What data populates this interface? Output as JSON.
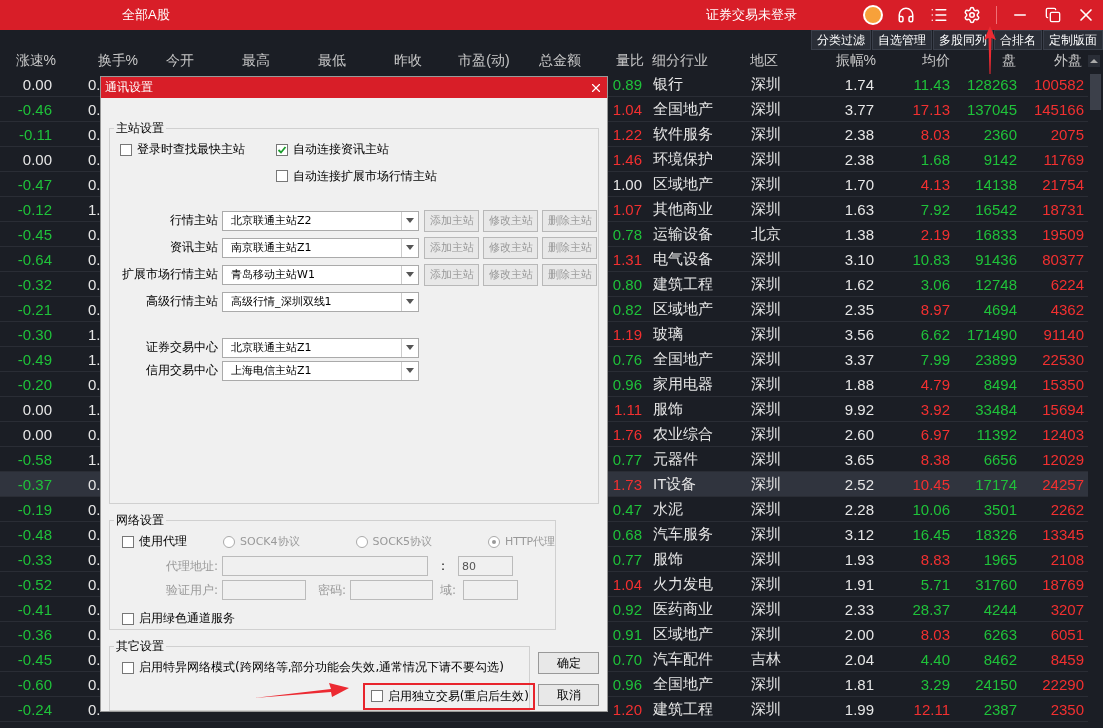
{
  "top_bar": {
    "title": "全部A股",
    "status": "证券交易未登录"
  },
  "toolbar": [
    "分类过滤",
    "自选管理",
    "多股同列",
    "合排名",
    "定制版面"
  ],
  "table": {
    "columns": [
      "涨速%",
      "换手%",
      "今开",
      "最高",
      "最低",
      "昨收",
      "市盈(动)",
      "总金额",
      "量比",
      "细分行业",
      "地区",
      "振幅%",
      "均价",
      "盘",
      "外盘"
    ],
    "rows": [
      {
        "selected": false,
        "cells": [
          {
            "text": "0.00",
            "color": "#e6e6e6"
          },
          {
            "text": "0.",
            "color": "#e6e6e6"
          },
          null,
          null,
          null,
          null,
          null,
          null,
          {
            "text": "0.89",
            "color": "#1fc23a"
          },
          {
            "text": "银行",
            "color": "#e6e6e6"
          },
          {
            "text": "深圳",
            "color": "#e6e6e6"
          },
          {
            "text": "1.74",
            "color": "#e6e6e6"
          },
          {
            "text": "11.43",
            "color": "#1fc23a"
          },
          {
            "text": "128263",
            "color": "#1fc23a"
          },
          {
            "text": "100582",
            "color": "#f23030"
          }
        ]
      },
      {
        "selected": false,
        "cells": [
          {
            "text": "-0.46",
            "color": "#1fc23a"
          },
          {
            "text": "0.",
            "color": "#e6e6e6"
          },
          null,
          null,
          null,
          null,
          null,
          null,
          {
            "text": "1.04",
            "color": "#f23030"
          },
          {
            "text": "全国地产",
            "color": "#e6e6e6"
          },
          {
            "text": "深圳",
            "color": "#e6e6e6"
          },
          {
            "text": "3.77",
            "color": "#e6e6e6"
          },
          {
            "text": "17.13",
            "color": "#f23030"
          },
          {
            "text": "137045",
            "color": "#1fc23a"
          },
          {
            "text": "145166",
            "color": "#f23030"
          }
        ]
      },
      {
        "selected": false,
        "cells": [
          {
            "text": "-0.11",
            "color": "#1fc23a"
          },
          {
            "text": "0.",
            "color": "#e6e6e6"
          },
          null,
          null,
          null,
          null,
          null,
          null,
          {
            "text": "1.22",
            "color": "#f23030"
          },
          {
            "text": "软件服务",
            "color": "#e6e6e6"
          },
          {
            "text": "深圳",
            "color": "#e6e6e6"
          },
          {
            "text": "2.38",
            "color": "#e6e6e6"
          },
          {
            "text": "8.03",
            "color": "#f23030"
          },
          {
            "text": "2360",
            "color": "#1fc23a"
          },
          {
            "text": "2075",
            "color": "#f23030"
          }
        ]
      },
      {
        "selected": false,
        "cells": [
          {
            "text": "0.00",
            "color": "#e6e6e6"
          },
          {
            "text": "0.",
            "color": "#e6e6e6"
          },
          null,
          null,
          null,
          null,
          null,
          null,
          {
            "text": "1.46",
            "color": "#f23030"
          },
          {
            "text": "环境保护",
            "color": "#e6e6e6"
          },
          {
            "text": "深圳",
            "color": "#e6e6e6"
          },
          {
            "text": "2.38",
            "color": "#e6e6e6"
          },
          {
            "text": "1.68",
            "color": "#1fc23a"
          },
          {
            "text": "9142",
            "color": "#1fc23a"
          },
          {
            "text": "11769",
            "color": "#f23030"
          }
        ]
      },
      {
        "selected": false,
        "cells": [
          {
            "text": "-0.47",
            "color": "#1fc23a"
          },
          {
            "text": "0.",
            "color": "#e6e6e6"
          },
          null,
          null,
          null,
          null,
          null,
          null,
          {
            "text": "1.00",
            "color": "#e6e6e6"
          },
          {
            "text": "区域地产",
            "color": "#e6e6e6"
          },
          {
            "text": "深圳",
            "color": "#e6e6e6"
          },
          {
            "text": "1.70",
            "color": "#e6e6e6"
          },
          {
            "text": "4.13",
            "color": "#f23030"
          },
          {
            "text": "14138",
            "color": "#1fc23a"
          },
          {
            "text": "21754",
            "color": "#f23030"
          }
        ]
      },
      {
        "selected": false,
        "cells": [
          {
            "text": "-0.12",
            "color": "#1fc23a"
          },
          {
            "text": "1.",
            "color": "#e6e6e6"
          },
          null,
          null,
          null,
          null,
          null,
          null,
          {
            "text": "1.07",
            "color": "#f23030"
          },
          {
            "text": "其他商业",
            "color": "#e6e6e6"
          },
          {
            "text": "深圳",
            "color": "#e6e6e6"
          },
          {
            "text": "1.63",
            "color": "#e6e6e6"
          },
          {
            "text": "7.92",
            "color": "#1fc23a"
          },
          {
            "text": "16542",
            "color": "#1fc23a"
          },
          {
            "text": "18731",
            "color": "#f23030"
          }
        ]
      },
      {
        "selected": false,
        "cells": [
          {
            "text": "-0.45",
            "color": "#1fc23a"
          },
          {
            "text": "0.",
            "color": "#e6e6e6"
          },
          null,
          null,
          null,
          null,
          null,
          null,
          {
            "text": "0.78",
            "color": "#1fc23a"
          },
          {
            "text": "运输设备",
            "color": "#e6e6e6"
          },
          {
            "text": "北京",
            "color": "#e6e6e6"
          },
          {
            "text": "1.38",
            "color": "#e6e6e6"
          },
          {
            "text": "2.19",
            "color": "#f23030"
          },
          {
            "text": "16833",
            "color": "#1fc23a"
          },
          {
            "text": "19509",
            "color": "#f23030"
          }
        ]
      },
      {
        "selected": false,
        "cells": [
          {
            "text": "-0.64",
            "color": "#1fc23a"
          },
          {
            "text": "0.",
            "color": "#e6e6e6"
          },
          null,
          null,
          null,
          null,
          null,
          null,
          {
            "text": "1.31",
            "color": "#f23030"
          },
          {
            "text": "电气设备",
            "color": "#e6e6e6"
          },
          {
            "text": "深圳",
            "color": "#e6e6e6"
          },
          {
            "text": "3.10",
            "color": "#e6e6e6"
          },
          {
            "text": "10.83",
            "color": "#1fc23a"
          },
          {
            "text": "91436",
            "color": "#1fc23a"
          },
          {
            "text": "80377",
            "color": "#f23030"
          }
        ]
      },
      {
        "selected": false,
        "cells": [
          {
            "text": "-0.32",
            "color": "#1fc23a"
          },
          {
            "text": "0.",
            "color": "#e6e6e6"
          },
          null,
          null,
          null,
          null,
          null,
          null,
          {
            "text": "0.80",
            "color": "#1fc23a"
          },
          {
            "text": "建筑工程",
            "color": "#e6e6e6"
          },
          {
            "text": "深圳",
            "color": "#e6e6e6"
          },
          {
            "text": "1.62",
            "color": "#e6e6e6"
          },
          {
            "text": "3.06",
            "color": "#1fc23a"
          },
          {
            "text": "12748",
            "color": "#1fc23a"
          },
          {
            "text": "6224",
            "color": "#f23030"
          }
        ]
      },
      {
        "selected": false,
        "cells": [
          {
            "text": "-0.21",
            "color": "#1fc23a"
          },
          {
            "text": "0.",
            "color": "#e6e6e6"
          },
          null,
          null,
          null,
          null,
          null,
          null,
          {
            "text": "0.82",
            "color": "#1fc23a"
          },
          {
            "text": "区域地产",
            "color": "#e6e6e6"
          },
          {
            "text": "深圳",
            "color": "#e6e6e6"
          },
          {
            "text": "2.35",
            "color": "#e6e6e6"
          },
          {
            "text": "8.97",
            "color": "#f23030"
          },
          {
            "text": "4694",
            "color": "#1fc23a"
          },
          {
            "text": "4362",
            "color": "#f23030"
          }
        ]
      },
      {
        "selected": false,
        "cells": [
          {
            "text": "-0.30",
            "color": "#1fc23a"
          },
          {
            "text": "1.",
            "color": "#e6e6e6"
          },
          null,
          null,
          null,
          null,
          null,
          null,
          {
            "text": "1.19",
            "color": "#f23030"
          },
          {
            "text": "玻璃",
            "color": "#e6e6e6"
          },
          {
            "text": "深圳",
            "color": "#e6e6e6"
          },
          {
            "text": "3.56",
            "color": "#e6e6e6"
          },
          {
            "text": "6.62",
            "color": "#1fc23a"
          },
          {
            "text": "171490",
            "color": "#1fc23a"
          },
          {
            "text": "91140",
            "color": "#f23030"
          }
        ]
      },
      {
        "selected": false,
        "cells": [
          {
            "text": "-0.49",
            "color": "#1fc23a"
          },
          {
            "text": "1.",
            "color": "#e6e6e6"
          },
          null,
          null,
          null,
          null,
          null,
          null,
          {
            "text": "0.76",
            "color": "#1fc23a"
          },
          {
            "text": "全国地产",
            "color": "#e6e6e6"
          },
          {
            "text": "深圳",
            "color": "#e6e6e6"
          },
          {
            "text": "3.37",
            "color": "#e6e6e6"
          },
          {
            "text": "7.99",
            "color": "#1fc23a"
          },
          {
            "text": "23899",
            "color": "#1fc23a"
          },
          {
            "text": "22530",
            "color": "#f23030"
          }
        ]
      },
      {
        "selected": false,
        "cells": [
          {
            "text": "-0.20",
            "color": "#1fc23a"
          },
          {
            "text": "0.",
            "color": "#e6e6e6"
          },
          null,
          null,
          null,
          null,
          null,
          null,
          {
            "text": "0.96",
            "color": "#1fc23a"
          },
          {
            "text": "家用电器",
            "color": "#e6e6e6"
          },
          {
            "text": "深圳",
            "color": "#e6e6e6"
          },
          {
            "text": "1.88",
            "color": "#e6e6e6"
          },
          {
            "text": "4.79",
            "color": "#f23030"
          },
          {
            "text": "8494",
            "color": "#1fc23a"
          },
          {
            "text": "15350",
            "color": "#f23030"
          }
        ]
      },
      {
        "selected": false,
        "cells": [
          {
            "text": "0.00",
            "color": "#e6e6e6"
          },
          {
            "text": "1.",
            "color": "#e6e6e6"
          },
          null,
          null,
          null,
          null,
          null,
          null,
          {
            "text": "1.11",
            "color": "#f23030"
          },
          {
            "text": "服饰",
            "color": "#e6e6e6"
          },
          {
            "text": "深圳",
            "color": "#e6e6e6"
          },
          {
            "text": "9.92",
            "color": "#e6e6e6"
          },
          {
            "text": "3.92",
            "color": "#f23030"
          },
          {
            "text": "33484",
            "color": "#1fc23a"
          },
          {
            "text": "15694",
            "color": "#f23030"
          }
        ]
      },
      {
        "selected": false,
        "cells": [
          {
            "text": "0.00",
            "color": "#e6e6e6"
          },
          {
            "text": "0.",
            "color": "#e6e6e6"
          },
          null,
          null,
          null,
          null,
          null,
          null,
          {
            "text": "1.76",
            "color": "#f23030"
          },
          {
            "text": "农业综合",
            "color": "#e6e6e6"
          },
          {
            "text": "深圳",
            "color": "#e6e6e6"
          },
          {
            "text": "2.60",
            "color": "#e6e6e6"
          },
          {
            "text": "6.97",
            "color": "#f23030"
          },
          {
            "text": "11392",
            "color": "#1fc23a"
          },
          {
            "text": "12403",
            "color": "#f23030"
          }
        ]
      },
      {
        "selected": false,
        "cells": [
          {
            "text": "-0.58",
            "color": "#1fc23a"
          },
          {
            "text": "1.",
            "color": "#e6e6e6"
          },
          null,
          null,
          null,
          null,
          null,
          null,
          {
            "text": "0.77",
            "color": "#1fc23a"
          },
          {
            "text": "元器件",
            "color": "#e6e6e6"
          },
          {
            "text": "深圳",
            "color": "#e6e6e6"
          },
          {
            "text": "3.65",
            "color": "#e6e6e6"
          },
          {
            "text": "8.38",
            "color": "#f23030"
          },
          {
            "text": "6656",
            "color": "#1fc23a"
          },
          {
            "text": "12029",
            "color": "#f23030"
          }
        ]
      },
      {
        "selected": true,
        "cells": [
          {
            "text": "-0.37",
            "color": "#1fc23a"
          },
          {
            "text": "0.",
            "color": "#e6e6e6"
          },
          null,
          null,
          null,
          null,
          null,
          null,
          {
            "text": "1.73",
            "color": "#f23030"
          },
          {
            "text": "IT设备",
            "color": "#e6e6e6"
          },
          {
            "text": "深圳",
            "color": "#e6e6e6"
          },
          {
            "text": "2.52",
            "color": "#e6e6e6"
          },
          {
            "text": "10.45",
            "color": "#f23030"
          },
          {
            "text": "17174",
            "color": "#1fc23a"
          },
          {
            "text": "24257",
            "color": "#f23030"
          }
        ]
      },
      {
        "selected": false,
        "cells": [
          {
            "text": "-0.19",
            "color": "#1fc23a"
          },
          {
            "text": "0.",
            "color": "#e6e6e6"
          },
          null,
          null,
          null,
          null,
          null,
          null,
          {
            "text": "0.47",
            "color": "#1fc23a"
          },
          {
            "text": "水泥",
            "color": "#e6e6e6"
          },
          {
            "text": "深圳",
            "color": "#e6e6e6"
          },
          {
            "text": "2.28",
            "color": "#e6e6e6"
          },
          {
            "text": "10.06",
            "color": "#1fc23a"
          },
          {
            "text": "3501",
            "color": "#1fc23a"
          },
          {
            "text": "2262",
            "color": "#f23030"
          }
        ]
      },
      {
        "selected": false,
        "cells": [
          {
            "text": "-0.48",
            "color": "#1fc23a"
          },
          {
            "text": "0.",
            "color": "#e6e6e6"
          },
          null,
          null,
          null,
          null,
          null,
          null,
          {
            "text": "0.68",
            "color": "#1fc23a"
          },
          {
            "text": "汽车服务",
            "color": "#e6e6e6"
          },
          {
            "text": "深圳",
            "color": "#e6e6e6"
          },
          {
            "text": "3.12",
            "color": "#e6e6e6"
          },
          {
            "text": "16.45",
            "color": "#1fc23a"
          },
          {
            "text": "18326",
            "color": "#1fc23a"
          },
          {
            "text": "13345",
            "color": "#f23030"
          }
        ]
      },
      {
        "selected": false,
        "cells": [
          {
            "text": "-0.33",
            "color": "#1fc23a"
          },
          {
            "text": "0.",
            "color": "#e6e6e6"
          },
          null,
          null,
          null,
          null,
          null,
          null,
          {
            "text": "0.77",
            "color": "#1fc23a"
          },
          {
            "text": "服饰",
            "color": "#e6e6e6"
          },
          {
            "text": "深圳",
            "color": "#e6e6e6"
          },
          {
            "text": "1.93",
            "color": "#e6e6e6"
          },
          {
            "text": "8.83",
            "color": "#f23030"
          },
          {
            "text": "1965",
            "color": "#1fc23a"
          },
          {
            "text": "2108",
            "color": "#f23030"
          }
        ]
      },
      {
        "selected": false,
        "cells": [
          {
            "text": "-0.52",
            "color": "#1fc23a"
          },
          {
            "text": "0.",
            "color": "#e6e6e6"
          },
          null,
          null,
          null,
          null,
          null,
          null,
          {
            "text": "1.04",
            "color": "#f23030"
          },
          {
            "text": "火力发电",
            "color": "#e6e6e6"
          },
          {
            "text": "深圳",
            "color": "#e6e6e6"
          },
          {
            "text": "1.91",
            "color": "#e6e6e6"
          },
          {
            "text": "5.71",
            "color": "#1fc23a"
          },
          {
            "text": "31760",
            "color": "#1fc23a"
          },
          {
            "text": "18769",
            "color": "#f23030"
          }
        ]
      },
      {
        "selected": false,
        "cells": [
          {
            "text": "-0.41",
            "color": "#1fc23a"
          },
          {
            "text": "0.",
            "color": "#e6e6e6"
          },
          null,
          null,
          null,
          null,
          null,
          null,
          {
            "text": "0.92",
            "color": "#1fc23a"
          },
          {
            "text": "医药商业",
            "color": "#e6e6e6"
          },
          {
            "text": "深圳",
            "color": "#e6e6e6"
          },
          {
            "text": "2.33",
            "color": "#e6e6e6"
          },
          {
            "text": "28.37",
            "color": "#1fc23a"
          },
          {
            "text": "4244",
            "color": "#1fc23a"
          },
          {
            "text": "3207",
            "color": "#f23030"
          }
        ]
      },
      {
        "selected": false,
        "cells": [
          {
            "text": "-0.36",
            "color": "#1fc23a"
          },
          {
            "text": "0.",
            "color": "#e6e6e6"
          },
          null,
          null,
          null,
          null,
          null,
          null,
          {
            "text": "0.91",
            "color": "#1fc23a"
          },
          {
            "text": "区域地产",
            "color": "#e6e6e6"
          },
          {
            "text": "深圳",
            "color": "#e6e6e6"
          },
          {
            "text": "2.00",
            "color": "#e6e6e6"
          },
          {
            "text": "8.03",
            "color": "#f23030"
          },
          {
            "text": "6263",
            "color": "#1fc23a"
          },
          {
            "text": "6051",
            "color": "#f23030"
          }
        ]
      },
      {
        "selected": false,
        "cells": [
          {
            "text": "-0.45",
            "color": "#1fc23a"
          },
          {
            "text": "0.",
            "color": "#e6e6e6"
          },
          null,
          null,
          null,
          null,
          null,
          null,
          {
            "text": "0.70",
            "color": "#1fc23a"
          },
          {
            "text": "汽车配件",
            "color": "#e6e6e6"
          },
          {
            "text": "吉林",
            "color": "#e6e6e6"
          },
          {
            "text": "2.04",
            "color": "#e6e6e6"
          },
          {
            "text": "4.40",
            "color": "#1fc23a"
          },
          {
            "text": "8462",
            "color": "#1fc23a"
          },
          {
            "text": "8459",
            "color": "#f23030"
          }
        ]
      },
      {
        "selected": false,
        "cells": [
          {
            "text": "-0.60",
            "color": "#1fc23a"
          },
          {
            "text": "0.",
            "color": "#e6e6e6"
          },
          null,
          null,
          null,
          null,
          null,
          null,
          {
            "text": "0.96",
            "color": "#1fc23a"
          },
          {
            "text": "全国地产",
            "color": "#e6e6e6"
          },
          {
            "text": "深圳",
            "color": "#e6e6e6"
          },
          {
            "text": "1.81",
            "color": "#e6e6e6"
          },
          {
            "text": "3.29",
            "color": "#1fc23a"
          },
          {
            "text": "24150",
            "color": "#1fc23a"
          },
          {
            "text": "22290",
            "color": "#f23030"
          }
        ]
      },
      {
        "selected": false,
        "cells": [
          {
            "text": "-0.24",
            "color": "#1fc23a"
          },
          {
            "text": "0.",
            "color": "#e6e6e6"
          },
          null,
          null,
          null,
          null,
          null,
          null,
          {
            "text": "1.20",
            "color": "#f23030"
          },
          {
            "text": "建筑工程",
            "color": "#e6e6e6"
          },
          {
            "text": "深圳",
            "color": "#e6e6e6"
          },
          {
            "text": "1.99",
            "color": "#e6e6e6"
          },
          {
            "text": "12.11",
            "color": "#f23030"
          },
          {
            "text": "2387",
            "color": "#1fc23a"
          },
          {
            "text": "2350",
            "color": "#f23030"
          }
        ]
      }
    ]
  },
  "dialog": {
    "title": "通讯设置",
    "main_station": {
      "title": "主站设置",
      "options": [
        {
          "label": "登录时查找最快主站",
          "checked": false
        },
        {
          "label": "自动连接资讯主站",
          "checked": true
        },
        {
          "label": "自动连接扩展市场行情主站",
          "checked": false
        }
      ],
      "servers": [
        {
          "label": "行情主站",
          "value": "北京联通主站Z2",
          "buttons": [
            {
              "label": "添加主站",
              "disabled": true
            },
            {
              "label": "修改主站",
              "disabled": true
            },
            {
              "label": "删除主站",
              "disabled": true
            }
          ]
        },
        {
          "label": "资讯主站",
          "value": "南京联通主站Z1",
          "buttons": [
            {
              "label": "添加主站",
              "disabled": true
            },
            {
              "label": "修改主站",
              "disabled": true
            },
            {
              "label": "删除主站",
              "disabled": true
            }
          ]
        },
        {
          "label": "扩展市场行情主站",
          "value": "青岛移动主站W1",
          "buttons": [
            {
              "label": "添加主站",
              "disabled": true
            },
            {
              "label": "修改主站",
              "disabled": true
            },
            {
              "label": "删除主站",
              "disabled": true
            }
          ]
        },
        {
          "label": "高级行情主站",
          "value": "高级行情_深圳双线1"
        }
      ],
      "trade_centers": [
        {
          "label": "证券交易中心",
          "value": "北京联通主站Z1"
        },
        {
          "label": "信用交易中心",
          "value": "上海电信主站Z1"
        }
      ]
    },
    "network": {
      "title": "网络设置",
      "use_proxy": {
        "label": "使用代理",
        "checked": false
      },
      "protocols": [
        {
          "label": "SOCK4协议",
          "selected": false
        },
        {
          "label": "SOCK5协议",
          "selected": false
        },
        {
          "label": "HTTP代理",
          "selected": true
        }
      ],
      "disabled": true,
      "address_label": "代理地址:",
      "port_separator": ":",
      "port": "80",
      "user_label": "验证用户:",
      "password_label": "密码:",
      "domain_label": "域:",
      "green_channel": {
        "label": "启用绿色通道服务",
        "checked": false
      }
    },
    "other": {
      "title": "其它设置",
      "special_network": {
        "label": "启用特异网络模式(跨网络等,部分功能会失效,通常情况下请不要勾选)",
        "checked": false
      },
      "independent_trade": {
        "label": "启用独立交易(重启后生效)",
        "checked": false
      }
    },
    "buttons": [
      "确定",
      "取消"
    ]
  }
}
